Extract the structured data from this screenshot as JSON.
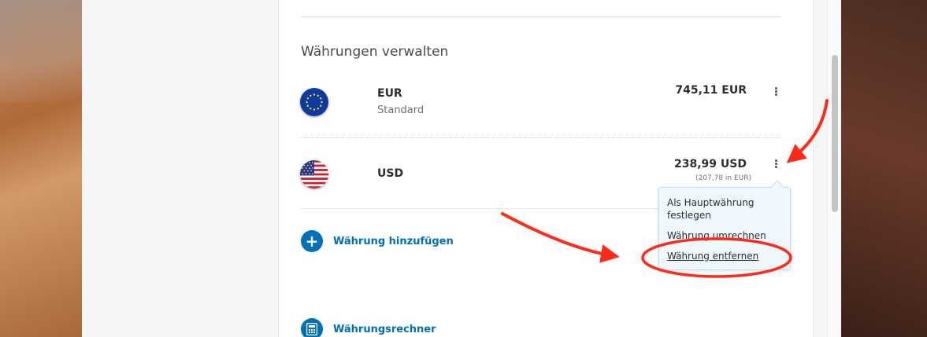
{
  "section": {
    "title": "Währungen verwalten"
  },
  "currencies": [
    {
      "code": "EUR",
      "subtitle": "Standard",
      "amount": "745,11 EUR",
      "converted": "",
      "flag_icon": "eu-flag-icon"
    },
    {
      "code": "USD",
      "subtitle": "",
      "amount": "238,99 USD",
      "converted": "(207,78 in EUR)",
      "flag_icon": "us-flag-icon"
    }
  ],
  "actions": {
    "add_currency": "Währung hinzufügen",
    "add_icon": "plus-circle-icon",
    "converter": "Währungsrechner",
    "converter_icon": "calculator-icon"
  },
  "menu": {
    "items": [
      "Als Hauptwährung festlegen",
      "Währung umrechnen",
      "Währung entfernen"
    ],
    "item0_line1": "Als Hauptwährung",
    "item0_line2": "festlegen"
  },
  "colors": {
    "accent": "#0070ba",
    "annotation": "#ff2a1a",
    "menu_bg": "#f1f8fd"
  }
}
